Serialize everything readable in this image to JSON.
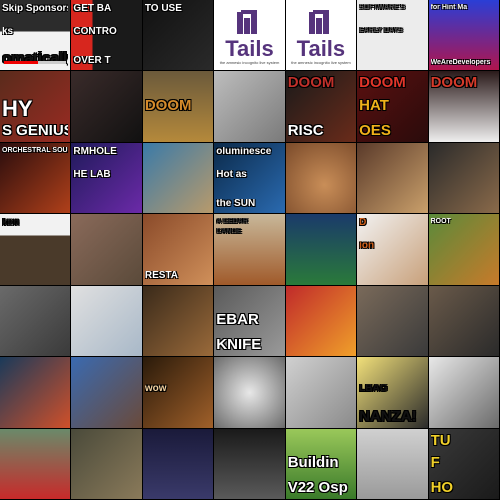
{
  "tiles": [
    {
      "id": "r0c0",
      "bg": "linear-gradient(180deg,#2c2c2c 0%,#2c2c2c 45%,#f2f2f2 45%,#f2f2f2 100%)",
      "lines": [
        {
          "text": "Skip Sponsorships",
          "pos": "tl",
          "size": "sm",
          "color": "#ffffff"
        },
        {
          "text": "ks",
          "pos": "mid",
          "size": "sm",
          "color": "#ffffff"
        },
        {
          "text": "omatically!",
          "pos": "bl",
          "size": "med",
          "color": "#111111"
        }
      ],
      "progress": 0.55
    },
    {
      "id": "r0c1",
      "bg": "linear-gradient(90deg,#d7261e 0%,#d7261e 30%,#1a1a1a 30%)",
      "lines": [
        {
          "text": "GET BA",
          "pos": "tl",
          "size": "sm",
          "color": "#ffffff"
        },
        {
          "text": "CONTRO",
          "pos": "mid",
          "size": "sm",
          "color": "#ffffff"
        },
        {
          "text": "OVER T",
          "pos": "bl",
          "size": "sm",
          "color": "#ffffff"
        }
      ]
    },
    {
      "id": "r0c2",
      "bg": "linear-gradient(135deg,#111 0%,#2a2a2a 100%)",
      "lines": [
        {
          "text": "TO USE",
          "pos": "tl",
          "size": "sm",
          "color": "#ffffff"
        }
      ]
    },
    {
      "id": "r0c3",
      "bg": "#ffffff",
      "tails": true,
      "word": "Tails",
      "sub": "the amnesic incognito live system"
    },
    {
      "id": "r0c4",
      "bg": "#ffffff",
      "tails": true,
      "word": "Tails",
      "sub": "the amnesic incognito live system"
    },
    {
      "id": "r0c5",
      "bg": "#ececec",
      "lines": [
        {
          "text": "SOFTWARE'S",
          "pos": "tl",
          "size": "xs",
          "color": "#555555"
        },
        {
          "text": "EARLY DAYS",
          "pos": "mid",
          "size": "xs",
          "color": "#555555"
        }
      ]
    },
    {
      "id": "r0c6",
      "bg": "linear-gradient(180deg,#2a3ed6 0%,#b0154d 100%)",
      "lines": [
        {
          "text": "for Hint Ma",
          "pos": "tl",
          "size": "xs",
          "color": "#ffffff"
        },
        {
          "text": "WeAreDevelopers",
          "pos": "bl",
          "size": "xs",
          "color": "#ffffff"
        }
      ]
    },
    {
      "id": "r1c0",
      "bg": "linear-gradient(135deg,#5a2b1c,#9a2b22)",
      "lines": [
        {
          "text": "HY",
          "pos": "mid",
          "size": "big",
          "color": "#ffffff"
        },
        {
          "text": "S GENIUS",
          "pos": "bl",
          "size": "med",
          "color": "#ffffff"
        }
      ]
    },
    {
      "id": "r1c1",
      "bg": "linear-gradient(135deg,#3a2b2a,#111)",
      "lines": []
    },
    {
      "id": "r1c2",
      "bg": "linear-gradient(180deg,#6b5a3b,#b5893b)",
      "lines": [
        {
          "text": "DOOM",
          "pos": "mid",
          "size": "med",
          "color": "#d58a2a"
        }
      ]
    },
    {
      "id": "r1c3",
      "bg": "linear-gradient(135deg,#bdbdbd,#7a7a7a)",
      "lines": []
    },
    {
      "id": "r1c4",
      "bg": "linear-gradient(135deg,#1a1a1a,#6a2b1a)",
      "lines": [
        {
          "text": "DOOM",
          "pos": "tl",
          "size": "med",
          "color": "#c0302a"
        },
        {
          "text": "RISC",
          "pos": "bl",
          "size": "med",
          "color": "#ffffff"
        }
      ]
    },
    {
      "id": "r1c5",
      "bg": "linear-gradient(135deg,#5a1010,#2a0b0b)",
      "lines": [
        {
          "text": "DOOM",
          "pos": "tl",
          "size": "med",
          "color": "#e2352a"
        },
        {
          "text": "HAT",
          "pos": "mid",
          "size": "med",
          "color": "#f0b11a"
        },
        {
          "text": "OES",
          "pos": "bl",
          "size": "med",
          "color": "#f0b11a"
        }
      ]
    },
    {
      "id": "r1c6",
      "bg": "linear-gradient(180deg,#2a1a1a,#efefef)",
      "lines": [
        {
          "text": "DOOM",
          "pos": "tl",
          "size": "med",
          "color": "#d63a2a"
        }
      ]
    },
    {
      "id": "r2c0",
      "bg": "linear-gradient(135deg,#2a0d0d,#b0401a)",
      "lines": [
        {
          "text": "ORCHESTRAL SOUNDTRACK",
          "pos": "tl",
          "size": "xs",
          "color": "#ffffff"
        }
      ]
    },
    {
      "id": "r2c1",
      "bg": "linear-gradient(135deg,#1f1a5a,#6b2aa8)",
      "lines": [
        {
          "text": "RMHOLE",
          "pos": "tl",
          "size": "sm",
          "color": "#ffffff"
        },
        {
          "text": "HE LAB",
          "pos": "mid",
          "size": "sm",
          "color": "#ffffff"
        }
      ]
    },
    {
      "id": "r2c2",
      "bg": "linear-gradient(135deg,#3a7aa8,#b89a6b)",
      "lines": []
    },
    {
      "id": "r2c3",
      "bg": "linear-gradient(135deg,#0b2a4a,#2a6ab0)",
      "lines": [
        {
          "text": "oluminesce",
          "pos": "tl",
          "size": "sm",
          "color": "#ffffff"
        },
        {
          "text": "Hot as",
          "pos": "mid",
          "size": "sm",
          "color": "#ffffff"
        },
        {
          "text": "the SUN",
          "pos": "bl",
          "size": "sm",
          "color": "#ffffff"
        }
      ]
    },
    {
      "id": "r2c4",
      "bg": "radial-gradient(circle at 55% 60%,#c98e58,#7a4a2a)",
      "lines": []
    },
    {
      "id": "r2c5",
      "bg": "linear-gradient(135deg,#5a3a2a,#caa06b)",
      "lines": []
    },
    {
      "id": "r2c6",
      "bg": "linear-gradient(135deg,#2a2a2a,#8a6a4a)",
      "lines": []
    },
    {
      "id": "r3c0",
      "bg": "linear-gradient(180deg,#f2f2f2 0%,#f2f2f2 30%,#4a3a2a 30%)",
      "lines": [
        {
          "text": "ken",
          "pos": "tl",
          "size": "sm",
          "color": "#111111"
        }
      ]
    },
    {
      "id": "r3c1",
      "bg": "linear-gradient(135deg,#8a6a5a,#5a4a3a)",
      "lines": []
    },
    {
      "id": "r3c2",
      "bg": "linear-gradient(135deg,#8a4a2a,#d0905a)",
      "lines": [
        {
          "text": "RESTA",
          "pos": "bl",
          "size": "sm",
          "color": "#ffffff"
        }
      ]
    },
    {
      "id": "r3c3",
      "bg": "linear-gradient(180deg,#c8b89a,#a05a2a)",
      "lines": [
        {
          "text": "A CEDAR",
          "pos": "tl",
          "size": "xs",
          "color": "#333333"
        },
        {
          "text": "CANOE",
          "pos": "tl",
          "size": "xs",
          "color": "#333333"
        }
      ]
    },
    {
      "id": "r3c4",
      "bg": "linear-gradient(180deg,#1a3a6a,#2a7a3a)",
      "lines": []
    },
    {
      "id": "r3c5",
      "bg": "linear-gradient(135deg,#f2f2f2,#c8a07a)",
      "lines": [
        {
          "text": "D",
          "pos": "tl",
          "size": "sm",
          "color": "#d0601a"
        },
        {
          "text": "ion",
          "pos": "mid",
          "size": "sm",
          "color": "#d0601a"
        }
      ]
    },
    {
      "id": "r3c6",
      "bg": "linear-gradient(135deg,#5a8a3a,#c87a2a)",
      "lines": [
        {
          "text": "ROOT",
          "pos": "tl",
          "size": "xs",
          "color": "#ffffff"
        }
      ]
    },
    {
      "id": "r4c0",
      "bg": "linear-gradient(135deg,#6a6a6a,#3a3a3a)",
      "lines": []
    },
    {
      "id": "r4c1",
      "bg": "linear-gradient(135deg,#e0e0e0,#a8b8c8)",
      "lines": []
    },
    {
      "id": "r4c2",
      "bg": "linear-gradient(135deg,#3a2a1a,#9a6a3a)",
      "lines": []
    },
    {
      "id": "r4c3",
      "bg": "linear-gradient(135deg,#5a5a5a,#9a9a9a)",
      "lines": [
        {
          "text": "EBAR",
          "pos": "mid",
          "size": "med",
          "color": "#ffffff"
        },
        {
          "text": "KNIFE",
          "pos": "bl",
          "size": "med",
          "color": "#ffffff"
        }
      ]
    },
    {
      "id": "r4c4",
      "bg": "linear-gradient(135deg,#c02a2a,#f0a02a)",
      "lines": []
    },
    {
      "id": "r4c5",
      "bg": "linear-gradient(135deg,#7a6a5a,#3a3a3a)",
      "lines": []
    },
    {
      "id": "r4c6",
      "bg": "linear-gradient(135deg,#6a5a4a,#2a2a2a)",
      "lines": []
    },
    {
      "id": "r5c0",
      "bg": "linear-gradient(135deg,#1a3a5a,#d0502a)",
      "lines": []
    },
    {
      "id": "r5c1",
      "bg": "linear-gradient(135deg,#3a6ab0,#6a4a3a)",
      "lines": []
    },
    {
      "id": "r5c2",
      "bg": "linear-gradient(135deg,#2a1a0a,#a0602a)",
      "lines": [
        {
          "text": "wow",
          "pos": "mid",
          "size": "sm",
          "color": "#f0d0a0"
        }
      ]
    },
    {
      "id": "r5c3",
      "bg": "radial-gradient(circle at 50% 50%,#e8e8e8,#6a6a6a)",
      "lines": []
    },
    {
      "id": "r5c4",
      "bg": "linear-gradient(135deg,#d0d0d0,#8a8a8a)",
      "lines": []
    },
    {
      "id": "r5c5",
      "bg": "linear-gradient(135deg,#f2e07a,#2a2a2a)",
      "lines": [
        {
          "text": "LBAG",
          "pos": "mid",
          "size": "sm",
          "color": "#111111"
        },
        {
          "text": "NANZA!",
          "pos": "bl",
          "size": "med",
          "color": "#111111"
        }
      ]
    },
    {
      "id": "r5c6",
      "bg": "linear-gradient(135deg,#e8e8e8,#6a6a6a)",
      "lines": []
    },
    {
      "id": "r6c0",
      "bg": "linear-gradient(180deg,#6a8a6a,#c82a2a)",
      "lines": []
    },
    {
      "id": "r6c1",
      "bg": "linear-gradient(135deg,#4a4a3a,#8a7a5a)",
      "lines": []
    },
    {
      "id": "r6c2",
      "bg": "linear-gradient(180deg,#1a1a3a,#3a3a6a)",
      "lines": []
    },
    {
      "id": "r6c3",
      "bg": "linear-gradient(180deg,#1a1a1a,#5a5a5a)",
      "lines": []
    },
    {
      "id": "r6c4",
      "bg": "linear-gradient(180deg,#9ac85a,#3a7a2a)",
      "lines": [
        {
          "text": "Buildin",
          "pos": "mid",
          "size": "med",
          "color": "#ffffff"
        },
        {
          "text": "V22 Osp",
          "pos": "bl",
          "size": "med",
          "color": "#ffffff"
        }
      ]
    },
    {
      "id": "r6c5",
      "bg": "linear-gradient(180deg,#d0d0d0,#9a9a9a)",
      "lines": []
    },
    {
      "id": "r6c6",
      "bg": "linear-gradient(135deg,#3a3a3a,#1a1a1a)",
      "lines": [
        {
          "text": "TU",
          "pos": "tl",
          "size": "med",
          "color": "#f0d02a"
        },
        {
          "text": "F",
          "pos": "mid",
          "size": "med",
          "color": "#f0d02a"
        },
        {
          "text": "HO",
          "pos": "bl",
          "size": "med",
          "color": "#f0d02a"
        }
      ]
    }
  ]
}
